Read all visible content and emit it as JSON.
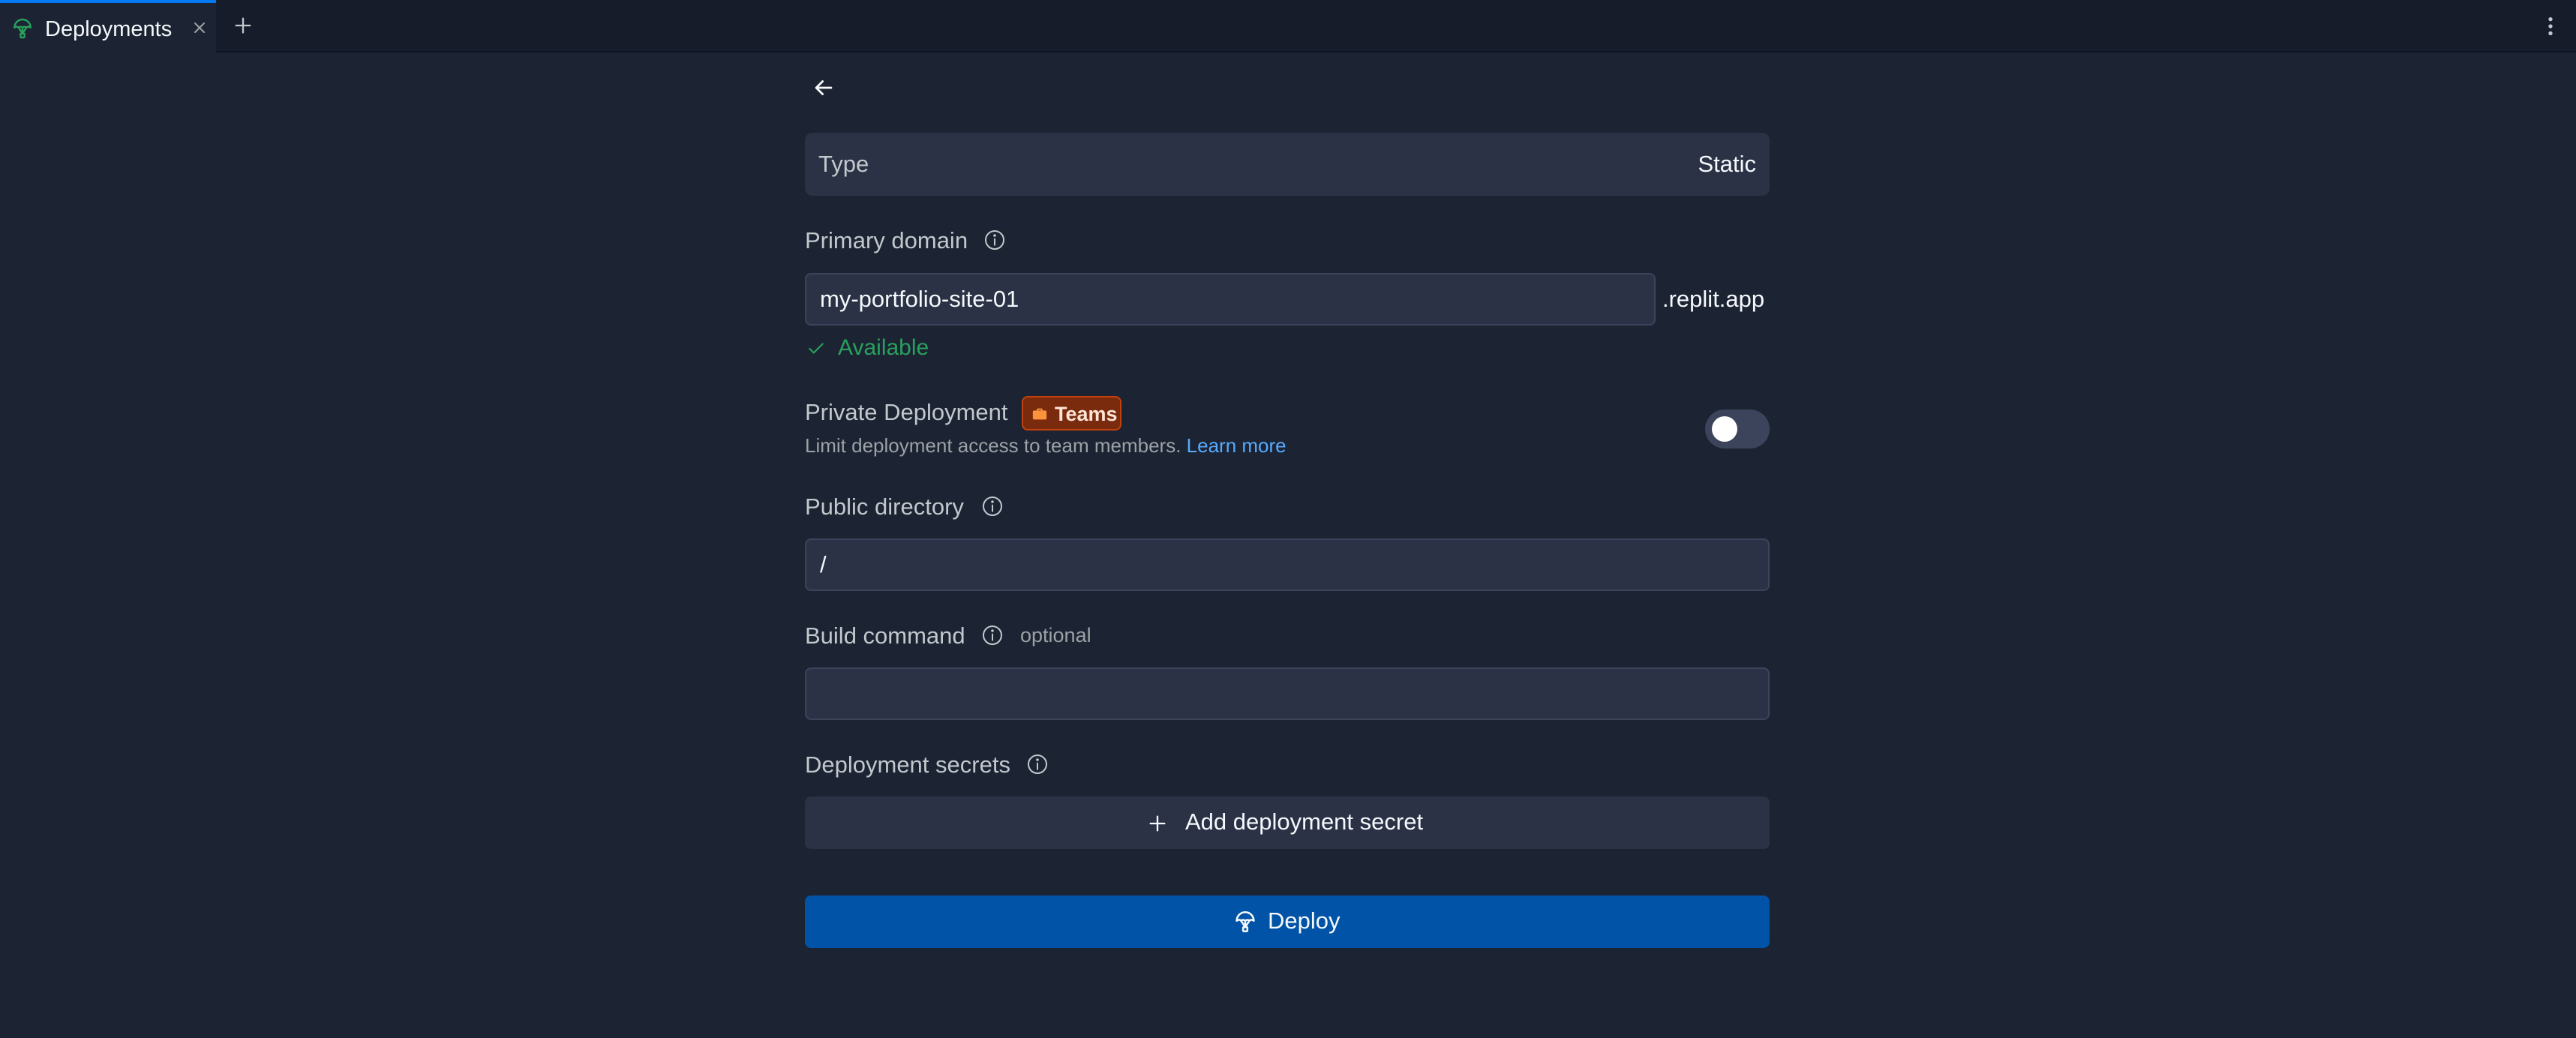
{
  "tabs": [
    {
      "label": "Deployments",
      "icon": "deployments-icon",
      "active": true
    }
  ],
  "back_icon": "arrow-left-icon",
  "type": {
    "label": "Type",
    "value": "Static"
  },
  "primary_domain": {
    "label": "Primary domain",
    "value": "my-portfolio-site-01",
    "suffix": ".replit.app",
    "status": "Available",
    "status_color": "#29a15d"
  },
  "private_deployment": {
    "label": "Private Deployment",
    "badge": "Teams",
    "description": "Limit deployment access to team members.",
    "link": "Learn more",
    "enabled": false
  },
  "public_directory": {
    "label": "Public directory",
    "value": "/"
  },
  "build_command": {
    "label": "Build command",
    "optional": "optional",
    "value": ""
  },
  "deployment_secrets": {
    "label": "Deployment secrets",
    "add_label": "Add deployment secret"
  },
  "deploy": {
    "label": "Deploy"
  },
  "colors": {
    "background": "#1c2333",
    "surface": "#2b3245",
    "accent": "#0053a6",
    "link": "#57abff",
    "badge": "#7a2a0d"
  }
}
